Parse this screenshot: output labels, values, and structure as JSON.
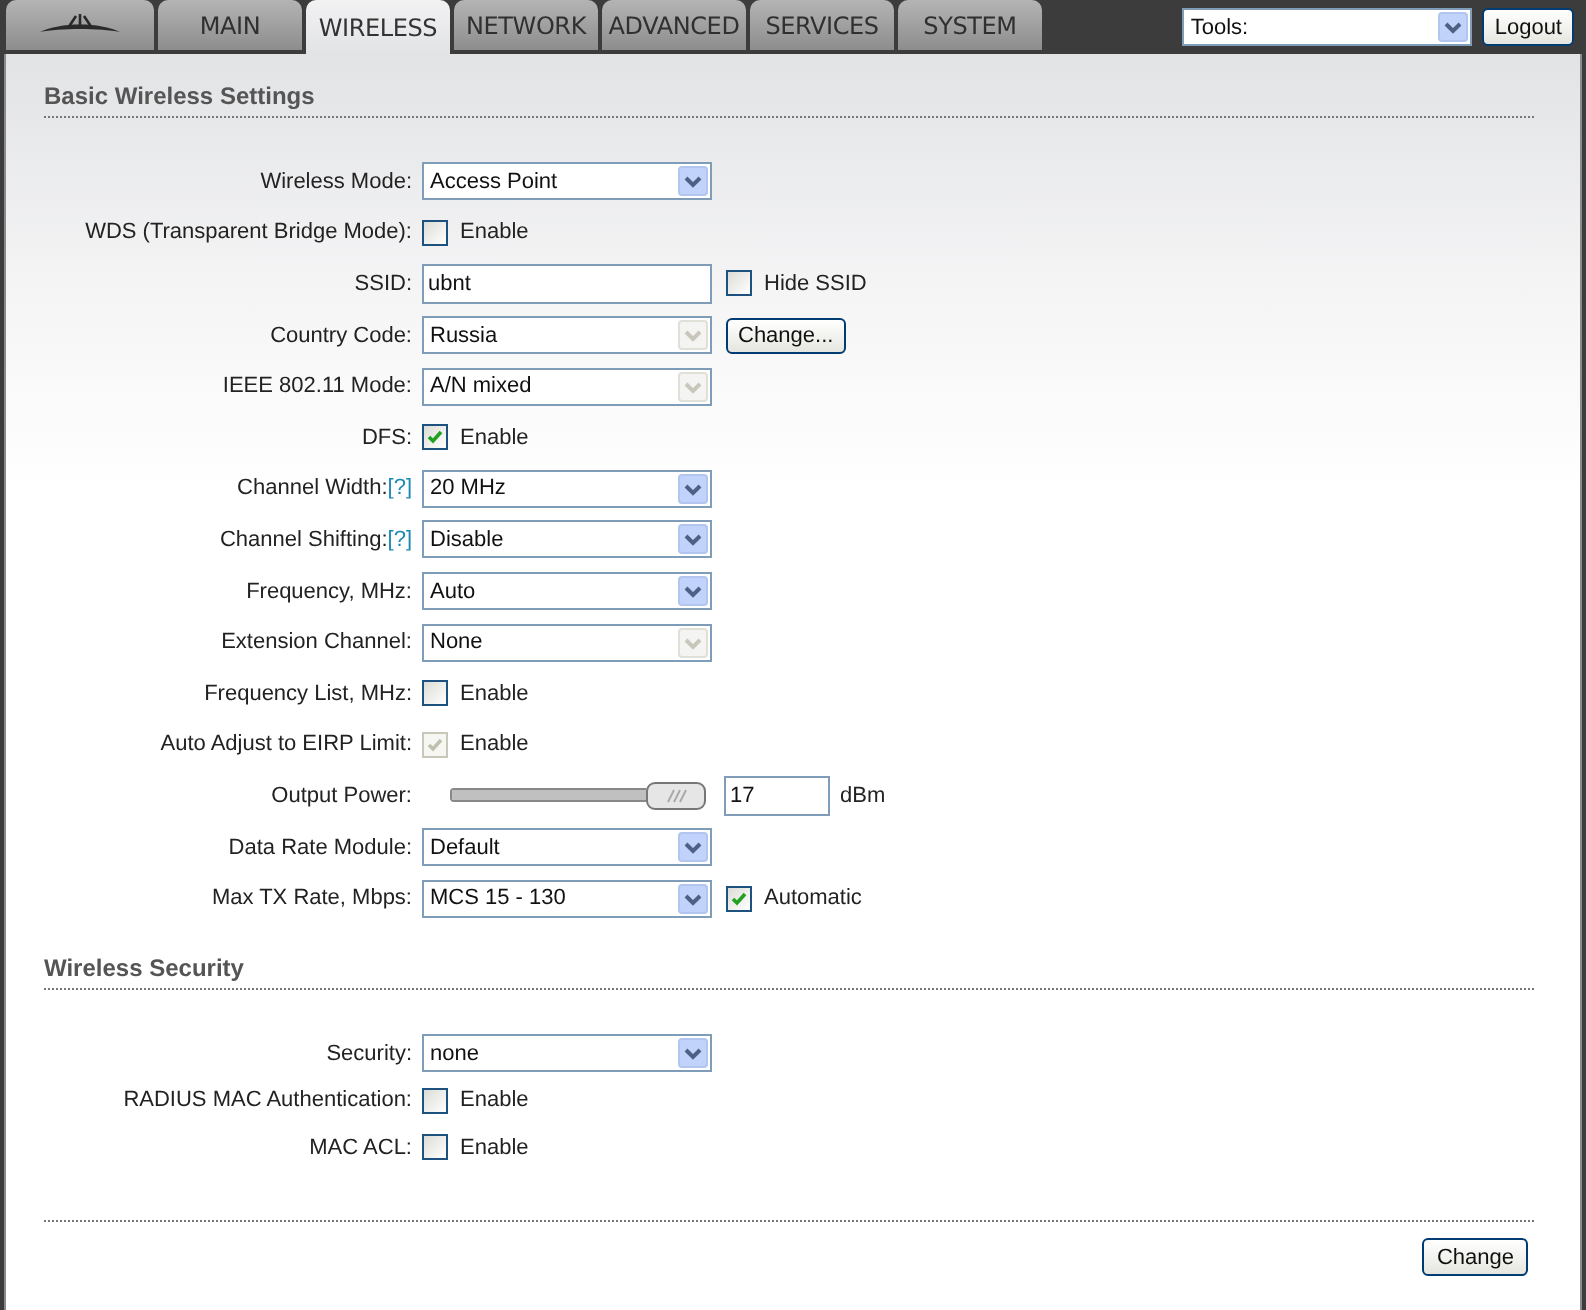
{
  "header": {
    "tabs": [
      {
        "label": "MAIN",
        "selected": false
      },
      {
        "label": "WIRELESS",
        "selected": true
      },
      {
        "label": "NETWORK",
        "selected": false
      },
      {
        "label": "ADVANCED",
        "selected": false
      },
      {
        "label": "SERVICES",
        "selected": false
      },
      {
        "label": "SYSTEM",
        "selected": false
      }
    ],
    "tools": {
      "value": "Tools:"
    },
    "logout": "Logout"
  },
  "sections": [
    {
      "title": "Basic Wireless Settings",
      "rows": [
        {
          "kind": "select",
          "label": "Wireless Mode:",
          "value": "Access Point",
          "disabled": false
        },
        {
          "kind": "checkbox",
          "label": "WDS (Transparent Bridge Mode):",
          "text": "Enable",
          "checked": false,
          "disabled": false
        },
        {
          "kind": "text",
          "label": "SSID:",
          "value": "ubnt",
          "extra": {
            "kind": "checkbox",
            "text": "Hide SSID",
            "checked": false,
            "disabled": false
          }
        },
        {
          "kind": "select",
          "label": "Country Code:",
          "value": "Russia",
          "disabled": true,
          "extra": {
            "kind": "button",
            "text": "Change..."
          }
        },
        {
          "kind": "select",
          "label": "IEEE 802.11 Mode:",
          "value": "A/N mixed",
          "disabled": true
        },
        {
          "kind": "checkbox",
          "label": "DFS:",
          "text": "Enable",
          "checked": true,
          "disabled": false
        },
        {
          "kind": "select",
          "label": "Channel Width:",
          "help": "[?]",
          "value": "20 MHz",
          "disabled": false
        },
        {
          "kind": "select",
          "label": "Channel Shifting:",
          "help": "[?]",
          "value": "Disable",
          "disabled": false
        },
        {
          "kind": "select",
          "label": "Frequency, MHz:",
          "value": "Auto",
          "disabled": false
        },
        {
          "kind": "select",
          "label": "Extension Channel:",
          "value": "None",
          "disabled": true
        },
        {
          "kind": "checkbox",
          "label": "Frequency List, MHz:",
          "text": "Enable",
          "checked": false,
          "disabled": false
        },
        {
          "kind": "checkbox",
          "label": "Auto Adjust to EIRP Limit:",
          "text": "Enable",
          "checked": true,
          "disabled": true
        },
        {
          "kind": "slider",
          "label": "Output Power:",
          "level": 1,
          "value": "17",
          "unit": "dBm"
        },
        {
          "kind": "select",
          "label": "Data Rate Module:",
          "value": "Default",
          "disabled": false
        },
        {
          "kind": "select",
          "label": "Max TX Rate, Mbps:",
          "value": "MCS 15 - 130",
          "disabled": false,
          "extra": {
            "kind": "checkbox",
            "text": "Automatic",
            "checked": true,
            "disabled": false
          }
        }
      ]
    },
    {
      "title": "Wireless Security",
      "rows": [
        {
          "kind": "select",
          "label": "Security:",
          "value": "none",
          "disabled": false
        },
        {
          "kind": "checkbox",
          "label": "RADIUS MAC Authentication:",
          "text": "Enable",
          "checked": false,
          "disabled": false
        },
        {
          "kind": "checkbox",
          "label": "MAC ACL:",
          "text": "Enable",
          "checked": false,
          "disabled": false
        }
      ]
    }
  ],
  "footer": {
    "button": "Change"
  }
}
